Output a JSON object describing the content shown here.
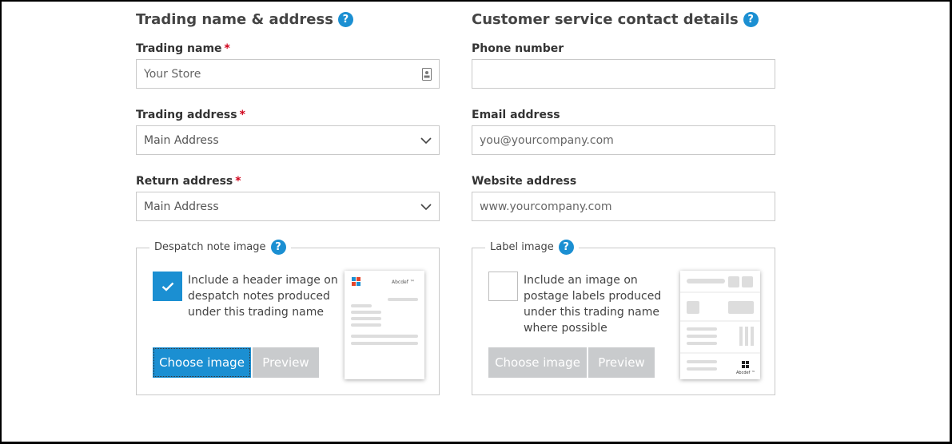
{
  "left": {
    "heading": "Trading name & address",
    "help": "?",
    "trading_name": {
      "label": "Trading name",
      "required": "*",
      "placeholder": "Your Store"
    },
    "trading_address": {
      "label": "Trading address",
      "required": "*",
      "value": "Main Address"
    },
    "return_address": {
      "label": "Return address",
      "required": "*",
      "value": "Main Address"
    },
    "despatch": {
      "legend": "Despatch note image",
      "checked": true,
      "checkbox_text": "Include a header image on despatch notes produced under this trading name",
      "choose_label": "Choose image",
      "preview_label": "Preview",
      "thumb_brand": "Abcdef ™"
    }
  },
  "right": {
    "heading": "Customer service contact details",
    "help": "?",
    "phone": {
      "label": "Phone number",
      "placeholder": ""
    },
    "email": {
      "label": "Email address",
      "placeholder": "you@yourcompany.com"
    },
    "website": {
      "label": "Website address",
      "placeholder": "www.yourcompany.com"
    },
    "label_image": {
      "legend": "Label image",
      "checked": false,
      "checkbox_text": "Include an image on postage labels produced under this trading name where possible",
      "choose_label": "Choose image",
      "preview_label": "Preview",
      "thumb_brand": "Abcdef ™"
    }
  },
  "colors": {
    "accent": "#1b8fd2",
    "required": "#d0021b",
    "disabled": "#c9cbcd"
  }
}
